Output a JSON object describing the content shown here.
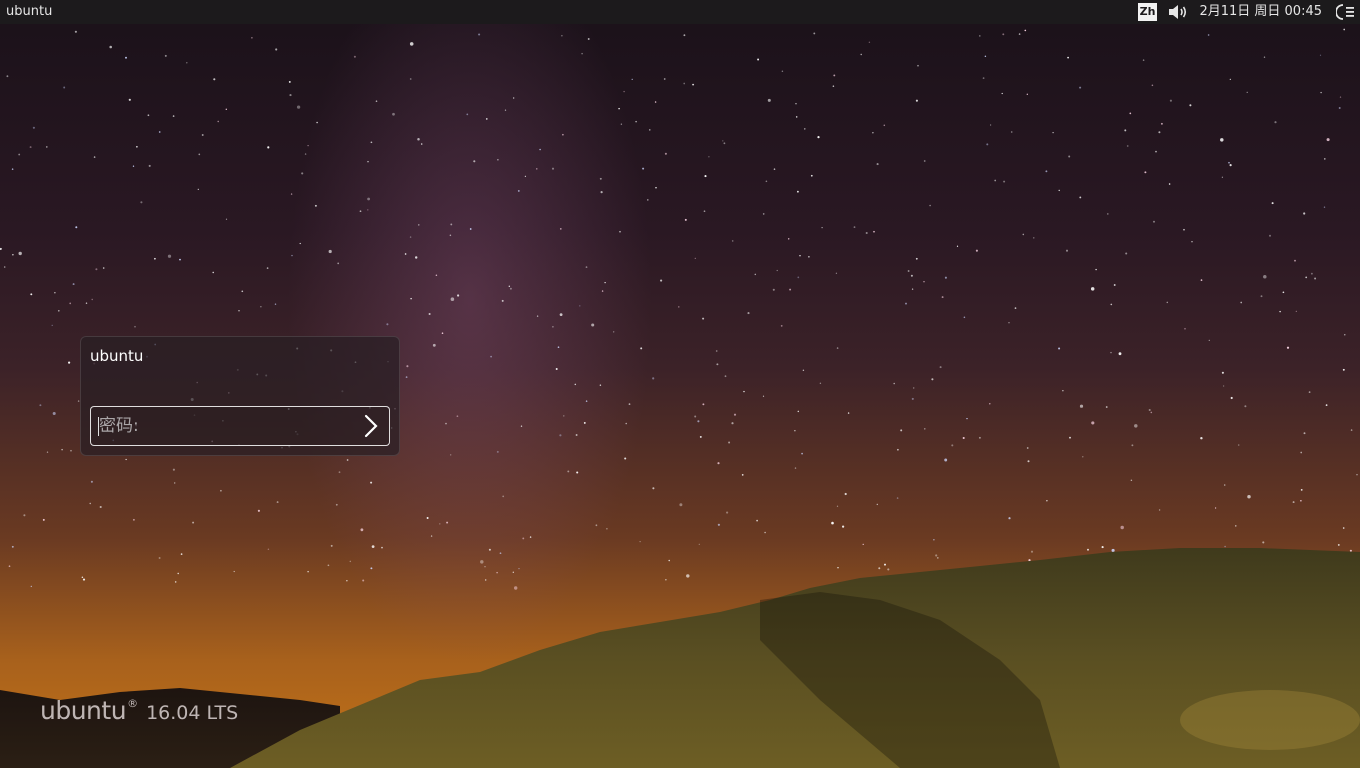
{
  "panel": {
    "hostname": "ubuntu",
    "keyboard_layout": "Zh",
    "clock": "2月11日 周日 00:45",
    "sound_icon": "speaker-volume-icon",
    "power_icon": "session-menu-icon"
  },
  "login": {
    "username": "ubuntu",
    "password_placeholder": "密码:",
    "password_value": "",
    "submit_icon": "chevron-right-icon"
  },
  "branding": {
    "logo_text": "ubuntu",
    "logo_mark": "®",
    "version": "16.04 LTS"
  },
  "colors": {
    "panel_bg": "#1c1a1c",
    "sky_top": "#1a1119",
    "horizon_glow": "#c47318"
  }
}
